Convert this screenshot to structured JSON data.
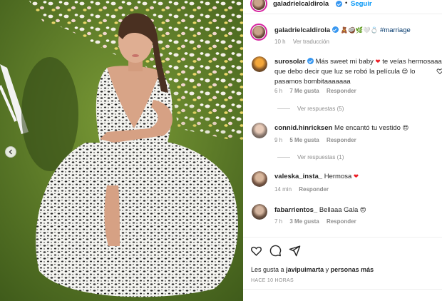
{
  "post_header": {
    "username": "galadrielcaldirola",
    "follow_label": "Seguir"
  },
  "caption": {
    "username": "galadrielcaldirola",
    "emojis": "🧸🥥🌿🤍💍",
    "hashtag": "#marriage",
    "time": "10 h",
    "translation": "Ver traducción"
  },
  "comments": [
    {
      "username": "surosolar",
      "text_1": "Más sweet mi baby",
      "text_2": "te veías hermosaaa que debo decir que luz se robó la película",
      "text_3": "lo pasamos bombitaaaaaaa",
      "time": "6 h",
      "likes": "7 Me gusta",
      "reply": "Responder",
      "view_replies": "Ver respuestas (5)"
    },
    {
      "username": "connid.hinricksen",
      "text": "Me encantó tu vestido",
      "time": "9 h",
      "likes": "5 Me gusta",
      "reply": "Responder",
      "view_replies": "Ver respuestas (1)"
    },
    {
      "username": "valeska_insta_",
      "text": "Hermosa",
      "time": "14 min",
      "reply": "Responder"
    },
    {
      "username": "fabarrientos_",
      "text": "Bellaaa Gala",
      "time": "7 h",
      "likes": "3 Me gusta",
      "reply": "Responder"
    }
  ],
  "footer": {
    "likes_prefix": "Les gusta a",
    "likes_user": "javipuimarta",
    "likes_connector": "y",
    "likes_others": "personas más",
    "time_ago": "HACE 10 HORAS"
  },
  "colors": {
    "accent_blue": "#0095f6",
    "hashtag": "#00376b",
    "meta_gray": "#8e8e8e",
    "heart_red": "#ed1c24"
  },
  "icons": [
    "chevron-left-icon",
    "verified-badge-icon",
    "heart-icon",
    "comment-icon",
    "share-icon"
  ]
}
